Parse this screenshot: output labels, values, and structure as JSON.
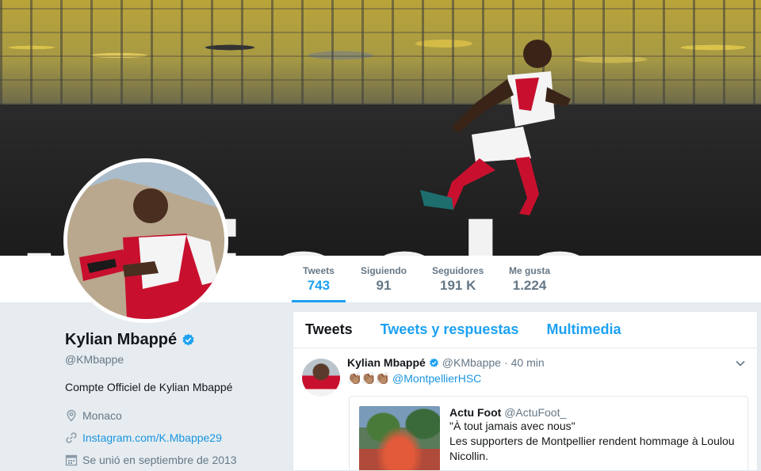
{
  "banner": {
    "board_text": "pricele"
  },
  "stats": [
    {
      "label": "Tweets",
      "value": "743"
    },
    {
      "label": "Siguiendo",
      "value": "91"
    },
    {
      "label": "Seguidores",
      "value": "191 K"
    },
    {
      "label": "Me gusta",
      "value": "1.224"
    }
  ],
  "profile": {
    "name": "Kylian Mbappé",
    "handle": "@KMbappe",
    "bio": "Compte Officiel de Kylian Mbappé",
    "location": "Monaco",
    "website": "Instagram.com/K.Mbappe29",
    "joined": "Se unió en septiembre de 2013"
  },
  "timeline": {
    "tabs": [
      "Tweets",
      "Tweets y respuestas",
      "Multimedia"
    ],
    "tweet": {
      "name": "Kylian Mbappé",
      "handle": "@KMbappe",
      "dot": "·",
      "time": "40 min",
      "claps": "👏🏽👏🏽👏🏽",
      "mention": "@MontpellierHSC",
      "quote": {
        "name": "Actu Foot",
        "handle": "@ActuFoot_",
        "line1": "\"À tout jamais avec nous\"",
        "line2": "Les supporters de Montpellier rendent hommage à Loulou",
        "line3": "Nicollin."
      }
    }
  },
  "colors": {
    "accent": "#1da1f2",
    "link": "#1b95e0",
    "muted": "#657786",
    "background": "#e6ecf0"
  }
}
